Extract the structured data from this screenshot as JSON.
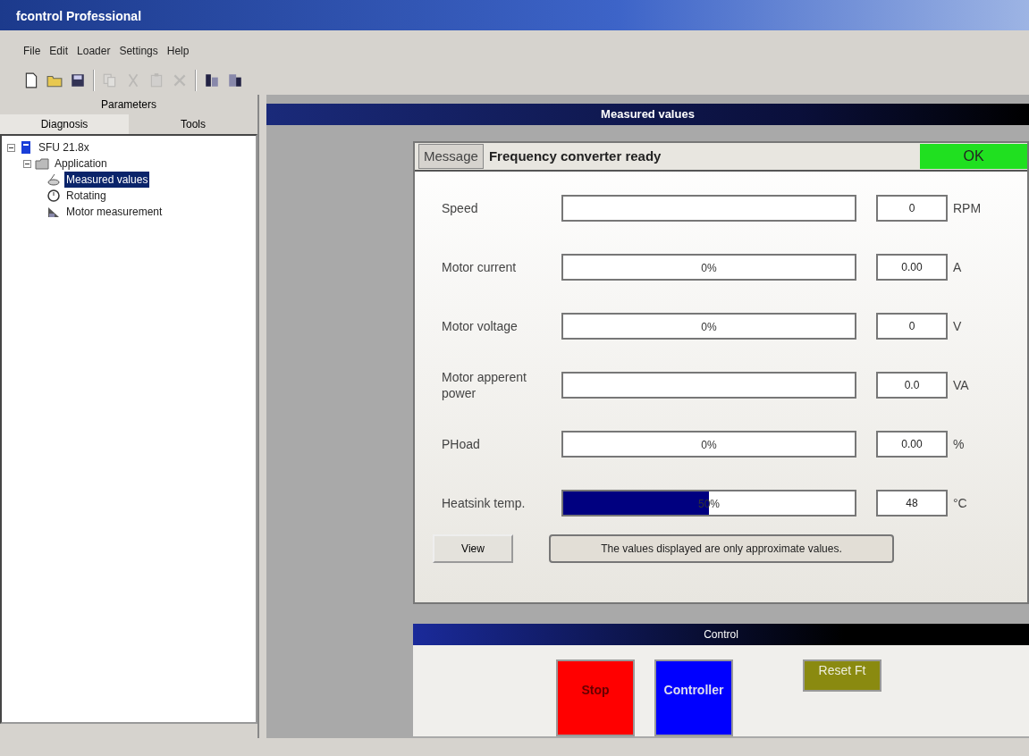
{
  "window": {
    "title": "fcontrol Professional"
  },
  "menu": [
    "File",
    "Edit",
    "Loader",
    "Settings",
    "Help"
  ],
  "toolbar": [
    {
      "kind": "new",
      "disabled": false
    },
    {
      "kind": "open",
      "disabled": false
    },
    {
      "kind": "save",
      "disabled": false
    },
    {
      "kind": "sep"
    },
    {
      "kind": "copy",
      "disabled": true
    },
    {
      "kind": "cut",
      "disabled": true
    },
    {
      "kind": "paste",
      "disabled": true
    },
    {
      "kind": "delete",
      "disabled": true
    },
    {
      "kind": "sep"
    },
    {
      "kind": "read",
      "disabled": false
    },
    {
      "kind": "write",
      "disabled": false
    }
  ],
  "sidebar": {
    "tabs": [
      {
        "label": "Parameters",
        "selected": false
      },
      {
        "label": "Diagnosis",
        "selected": true
      },
      {
        "label": "Tools",
        "selected": false
      }
    ],
    "tree": [
      {
        "label": "SFU 21.8x",
        "kind": "device",
        "expanded": true,
        "selected": false,
        "children": [
          {
            "label": "Application",
            "kind": "folder",
            "expanded": true,
            "selected": false,
            "children": [
              {
                "label": "Measured values",
                "kind": "measure",
                "selected": true
              },
              {
                "label": "Rotating",
                "kind": "rotate",
                "selected": false
              },
              {
                "label": "Motor measurement",
                "kind": "motor",
                "selected": false
              }
            ]
          }
        ]
      }
    ]
  },
  "main": {
    "title": "Measured values",
    "message": {
      "label": "Message",
      "text": "Frequency converter ready",
      "status": "OK"
    },
    "rows": [
      {
        "label": "Speed",
        "level": 0,
        "bar_text": "",
        "value": "0",
        "unit": "RPM"
      },
      {
        "label": "Motor current",
        "level": 0,
        "bar_text": "0%",
        "value": "0.00",
        "unit": "A"
      },
      {
        "label": "Motor voltage",
        "level": 0,
        "bar_text": "0%",
        "value": "0",
        "unit": "V"
      },
      {
        "label": "Motor apperent power",
        "level": 0,
        "bar_text": "",
        "value": "0.0",
        "unit": "VA"
      },
      {
        "label": "PHoad",
        "level": 0,
        "bar_text": "0%",
        "value": "0.00",
        "unit": "%"
      },
      {
        "label": "Heatsink temp.",
        "level": 0.5,
        "bar_text": "50%",
        "value": "48",
        "unit": "°C"
      }
    ],
    "view_button": "View",
    "note": "The values displayed are only approximate values.",
    "control": {
      "title": "Control",
      "buttons": [
        {
          "label": "Stop",
          "kind": "stop"
        },
        {
          "label": "Controller",
          "kind": "controller"
        },
        {
          "label": "Reset Ft",
          "kind": "reset"
        }
      ]
    }
  }
}
